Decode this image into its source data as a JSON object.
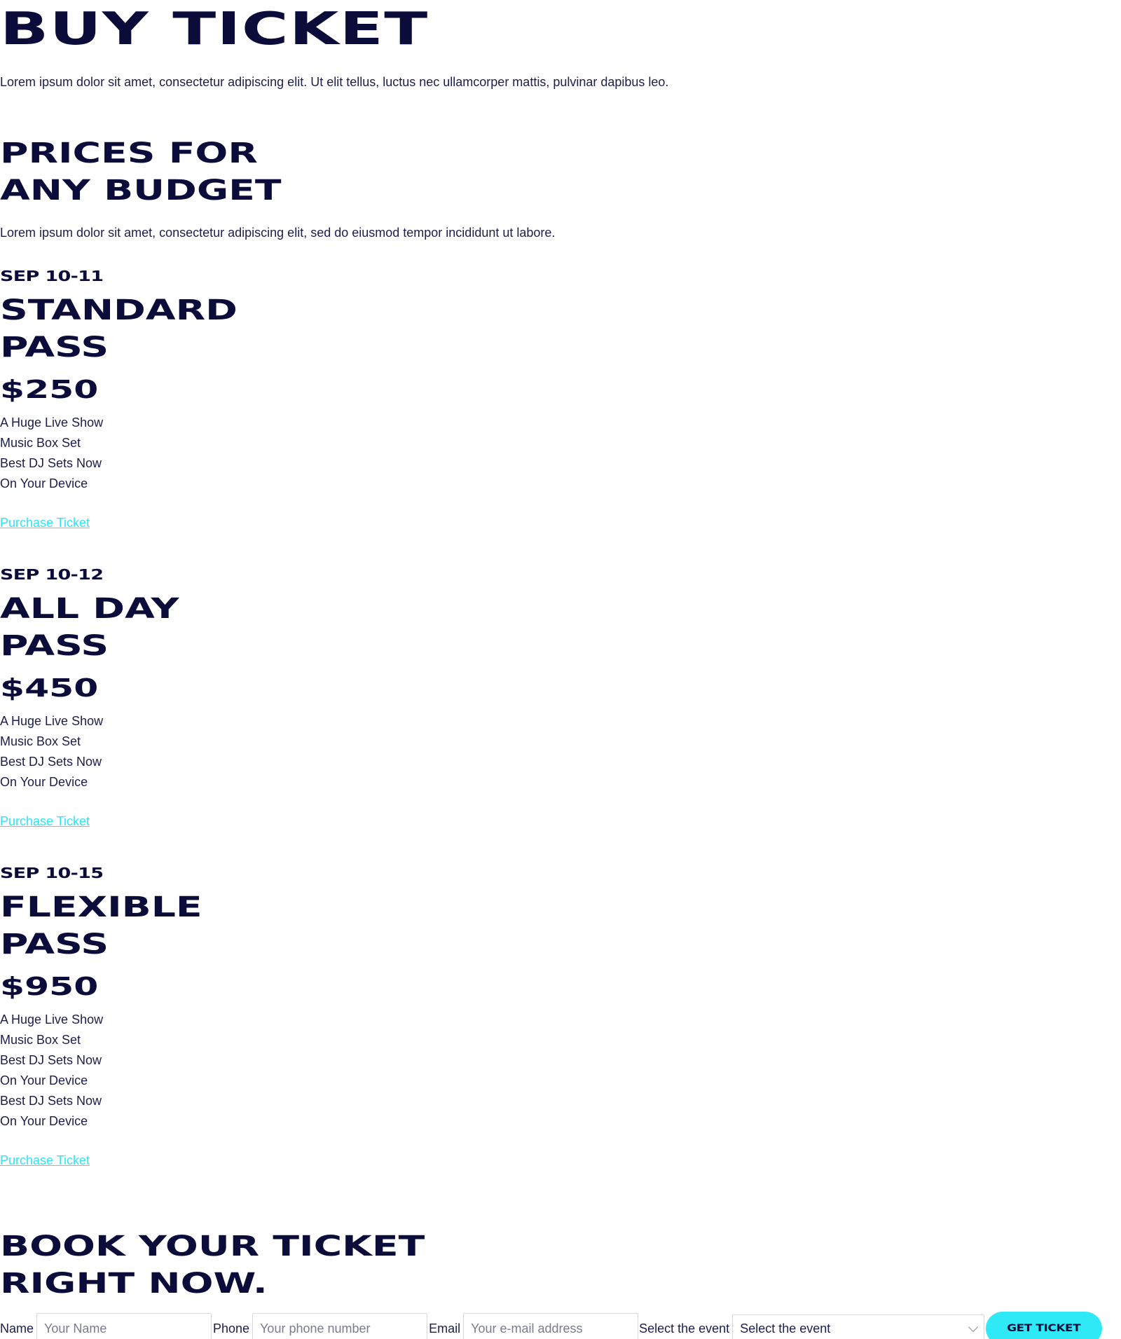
{
  "header": {
    "title": "BUY TICKET",
    "intro": "Lorem ipsum dolor sit amet, consectetur adipiscing elit. Ut elit tellus, luctus nec ullamcorper mattis, pulvinar dapibus leo."
  },
  "prices": {
    "title_line1": "PRICES FOR",
    "title_line2": "ANY BUDGET",
    "text": "Lorem ipsum dolor sit amet, consectetur adipiscing elit, sed do eiusmod tempor incididunt ut labore."
  },
  "passes": [
    {
      "date": "SEP 10-11",
      "name_line1": "STANDARD",
      "name_line2": "PASS",
      "price": "$250",
      "features": [
        "A Huge Live Show",
        "Music Box Set",
        "Best DJ Sets Now",
        "On Your Device"
      ],
      "link": "Purchase Ticket"
    },
    {
      "date": "SEP 10-12",
      "name_line1": "ALL DAY",
      "name_line2": "PASS",
      "price": "$450",
      "features": [
        "A Huge Live Show",
        "Music Box Set",
        "Best DJ Sets Now",
        "On Your Device"
      ],
      "link": "Purchase Ticket"
    },
    {
      "date": "SEP 10-15",
      "name_line1": "FLEXIBLE",
      "name_line2": "PASS",
      "price": "$950",
      "features": [
        "A Huge Live Show",
        "Music Box Set",
        "Best DJ Sets Now",
        "On Your Device",
        "Best DJ Sets Now",
        "On Your Device"
      ],
      "link": "Purchase Ticket"
    }
  ],
  "booking": {
    "title_line1": "BOOK YOUR TICKET",
    "title_line2": "RIGHT NOW.",
    "name_label": "Name",
    "name_placeholder": "Your Name",
    "phone_label": "Phone",
    "phone_placeholder": "Your phone number",
    "email_label": "Email",
    "email_placeholder": "Your e-mail address",
    "event_label": "Select the event",
    "event_selected": "Select the event",
    "submit_label": "GET TICKET"
  },
  "colors": {
    "heading": "#0b0c3a",
    "accent": "#2fe9f6",
    "link": "#2fe3f3"
  }
}
